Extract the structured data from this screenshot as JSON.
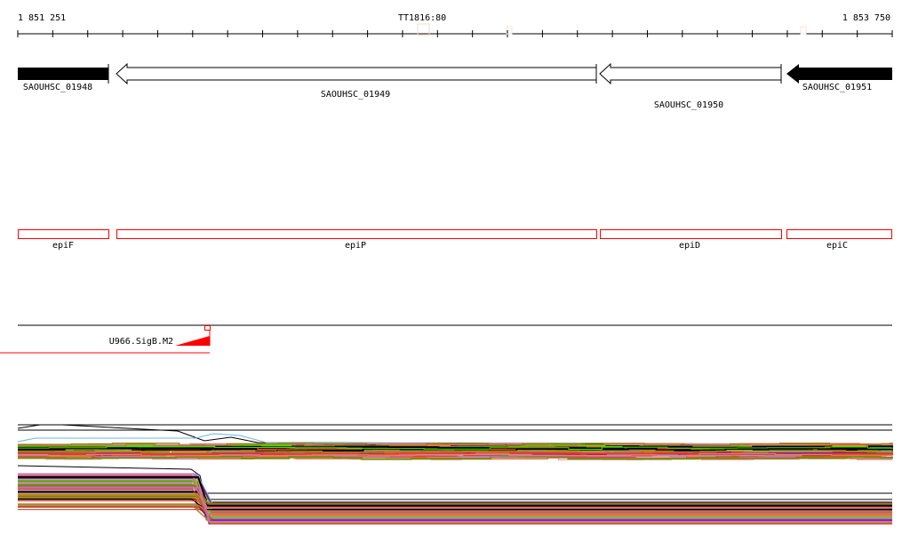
{
  "ruler": {
    "start_label": "1 851 251",
    "end_label": "1 853 750",
    "center_label": "TT1816:80",
    "tick_count": 26
  },
  "genes": [
    {
      "name": "SAOUHSC_01948",
      "strand": "-",
      "style": "filled"
    },
    {
      "name": "SAOUHSC_01949",
      "strand": "-",
      "style": "outline"
    },
    {
      "name": "SAOUHSC_01950",
      "strand": "-",
      "style": "outline"
    },
    {
      "name": "SAOUHSC_01951",
      "strand": "-",
      "style": "filled"
    }
  ],
  "features": [
    {
      "name": "epiF"
    },
    {
      "name": "epiP"
    },
    {
      "name": "epiD"
    },
    {
      "name": "epiC"
    }
  ],
  "promoter": {
    "name": "U966.SigB.M2",
    "color": "#ff0000"
  },
  "expression": {
    "palette": [
      "#000000",
      "#6cb4e8",
      "#c78fa0",
      "#a0a0d8",
      "#8b1a6b",
      "#d2691e",
      "#e03c3c",
      "#7a8a00",
      "#b8860b",
      "#40e000",
      "#ff7f50",
      "#9c6b30",
      "#cc66cc",
      "#808000",
      "#c04040"
    ]
  }
}
